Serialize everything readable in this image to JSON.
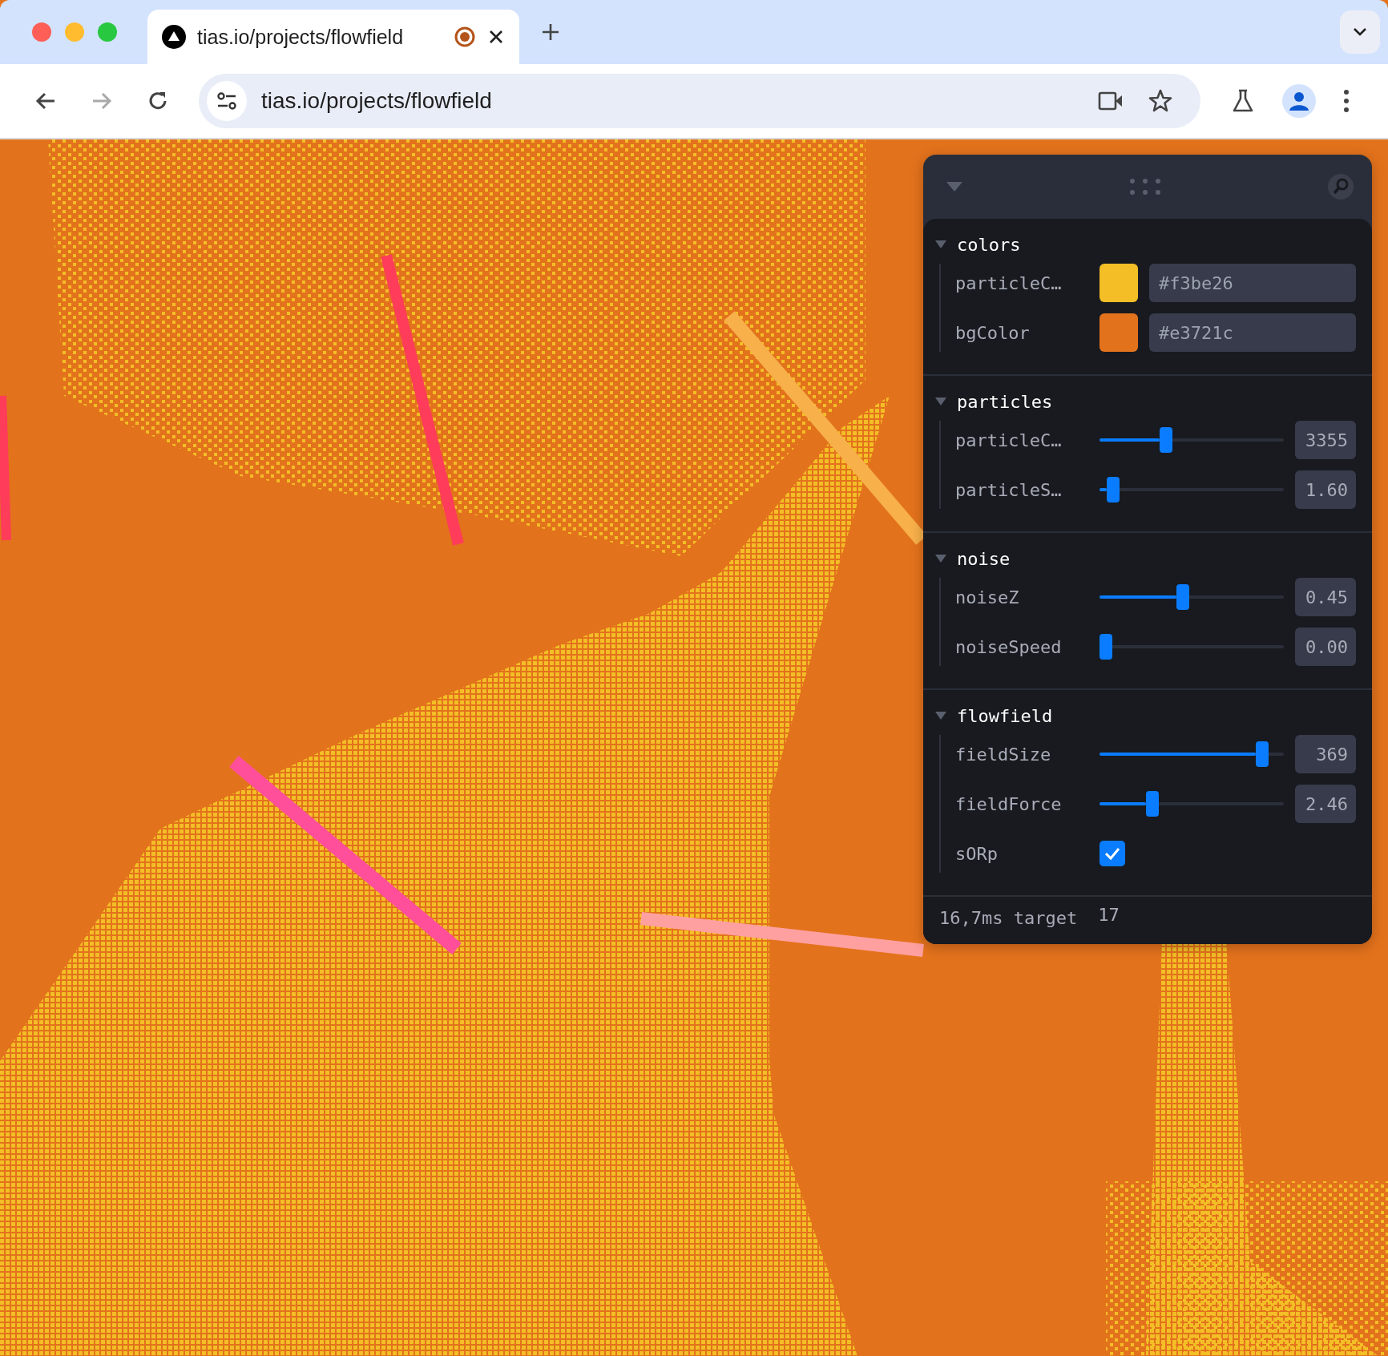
{
  "browser": {
    "tab": {
      "title": "tias.io/projects/flowfield",
      "selected": true,
      "recording": true
    },
    "address": "tias.io/projects/flowfield",
    "forward_disabled": true
  },
  "panel": {
    "folders": [
      {
        "title": "colors",
        "expanded": true,
        "controls": [
          {
            "kind": "color",
            "label": "particleC…",
            "color": "#f3be26",
            "value": "#f3be26"
          },
          {
            "kind": "color",
            "label": "bgColor",
            "color": "#e3721c",
            "value": "#e3721c"
          }
        ]
      },
      {
        "title": "particles",
        "expanded": true,
        "controls": [
          {
            "kind": "slider",
            "label": "particleC…",
            "level": 0.35,
            "value": "3355"
          },
          {
            "kind": "slider",
            "label": "particleS…",
            "level": 0.04,
            "value": "1.60"
          }
        ]
      },
      {
        "title": "noise",
        "expanded": true,
        "controls": [
          {
            "kind": "slider",
            "label": "noiseZ",
            "level": 0.45,
            "value": "0.45"
          },
          {
            "kind": "slider",
            "label": "noiseSpeed",
            "level": 0.0,
            "value": "0.00"
          }
        ]
      },
      {
        "title": "flowfield",
        "expanded": true,
        "controls": [
          {
            "kind": "slider",
            "label": "fieldSize",
            "level": 0.91,
            "value": "369"
          },
          {
            "kind": "slider",
            "label": "fieldForce",
            "level": 0.27,
            "value": "2.46"
          },
          {
            "kind": "checkbox",
            "label": "sORp",
            "checked": true
          }
        ]
      }
    ],
    "fps": {
      "label": "16,7ms target",
      "value": "17"
    }
  }
}
